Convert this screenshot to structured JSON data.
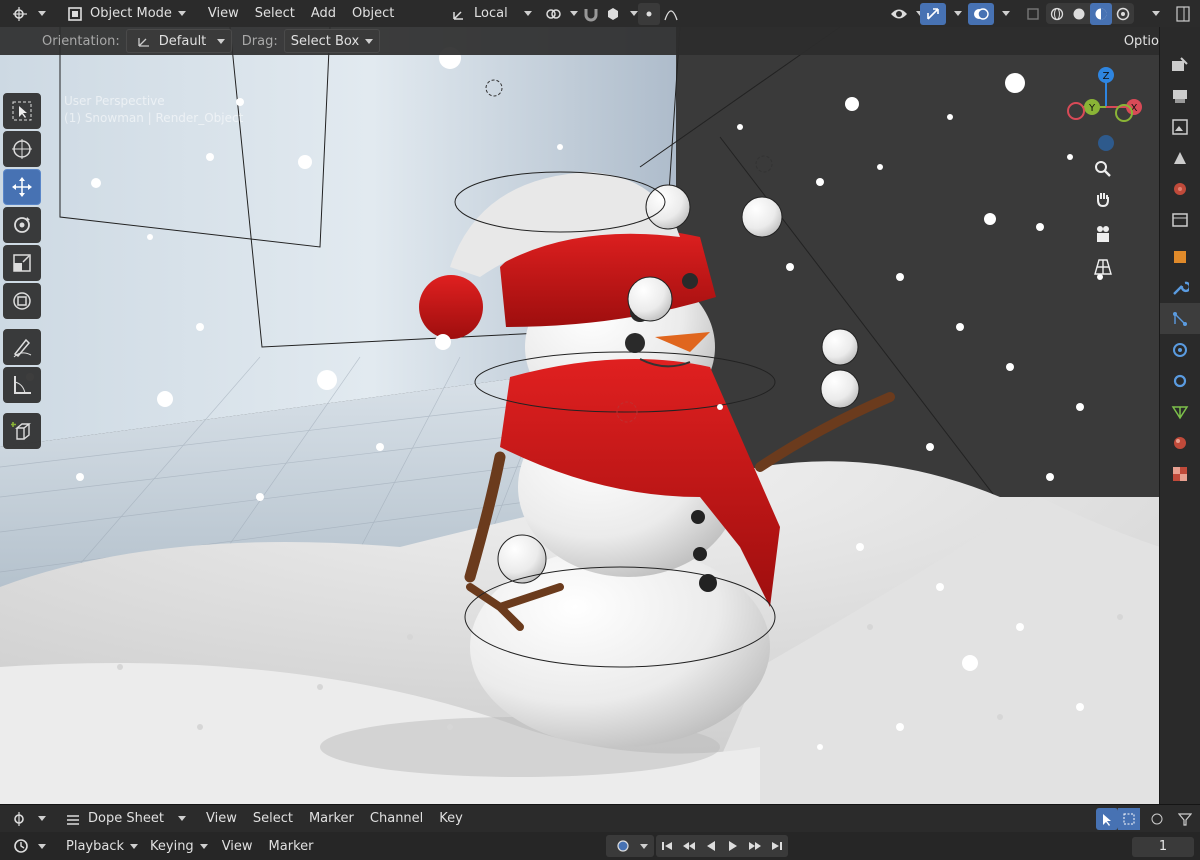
{
  "header": {
    "editor_type_icon": "editor-type-icon",
    "mode": "Object Mode",
    "menus": [
      "View",
      "Select",
      "Add",
      "Object"
    ],
    "transform_orientation": "Local"
  },
  "tool_header": {
    "orientation_label": "Orientation:",
    "orientation_value": "Default",
    "drag_label": "Drag:",
    "drag_value": "Select Box",
    "options_label": "Options"
  },
  "viewport": {
    "perspective_label": "User Perspective",
    "object_label": "(1) Snowman | Render_Object"
  },
  "toolbar": {
    "tools": [
      "select-box",
      "cursor",
      "move",
      "rotate",
      "scale",
      "transform",
      "annotate",
      "measure",
      "add-cube"
    ],
    "active_tool": "move"
  },
  "gizmo": {
    "axes": [
      "X",
      "Y",
      "Z"
    ]
  },
  "dope_sheet": {
    "mode": "Dope Sheet",
    "menus": [
      "View",
      "Select",
      "Marker",
      "Channel",
      "Key"
    ]
  },
  "timeline": {
    "menus": [
      "Playback",
      "Keying",
      "View",
      "Marker"
    ],
    "current_frame": "1"
  },
  "colors": {
    "accent": "#4772b3",
    "x_axis": "#d84a57",
    "y_axis": "#8ab436",
    "z_axis": "#2e85e0"
  }
}
